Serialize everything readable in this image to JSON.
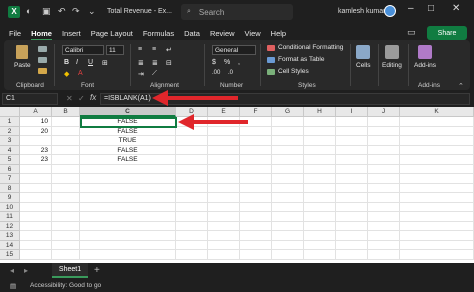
{
  "window": {
    "title": "Total Revenue - Ex...",
    "search_placeholder": "Search",
    "user_name": "kamlesh kumar"
  },
  "menu": {
    "items": [
      "File",
      "Home",
      "Insert",
      "Page Layout",
      "Formulas",
      "Data",
      "Review",
      "View",
      "Help"
    ],
    "share_label": "Share"
  },
  "ribbon": {
    "paste_label": "Paste",
    "clipboard_label": "Clipboard",
    "font_name": "Calibri",
    "font_size": "11",
    "bold": "B",
    "italic": "I",
    "underline": "U",
    "font_label": "Font",
    "alignment_label": "Alignment",
    "number_format": "General",
    "number_label": "Number",
    "conditional_formatting": "Conditional Formatting",
    "format_as_table": "Format as Table",
    "cell_styles": "Cell Styles",
    "styles_label": "Styles",
    "cells_label": "Cells",
    "editing_label": "Editing",
    "addins_label": "Add-ins"
  },
  "formula_bar": {
    "name_box": "C1",
    "fx": "fx",
    "formula": "=ISBLANK(A1)"
  },
  "grid": {
    "columns": [
      "A",
      "B",
      "C",
      "D",
      "E",
      "F",
      "G",
      "H",
      "I",
      "J",
      "K"
    ],
    "rows": [
      "1",
      "2",
      "3",
      "4",
      "5",
      "6",
      "7",
      "8",
      "9",
      "10",
      "11",
      "12",
      "13",
      "14",
      "15"
    ],
    "column_a": [
      "10",
      "20",
      "",
      "23",
      "23"
    ],
    "column_c": [
      "FALSE",
      "FALSE",
      "TRUE",
      "FALSE",
      "FALSE"
    ]
  },
  "sheets": {
    "active": "Sheet1",
    "add": "+"
  },
  "status": {
    "accessibility": "Accessibility: Good to go"
  },
  "colors": {
    "accent": "#107c41",
    "arrow": "#e0262b"
  }
}
